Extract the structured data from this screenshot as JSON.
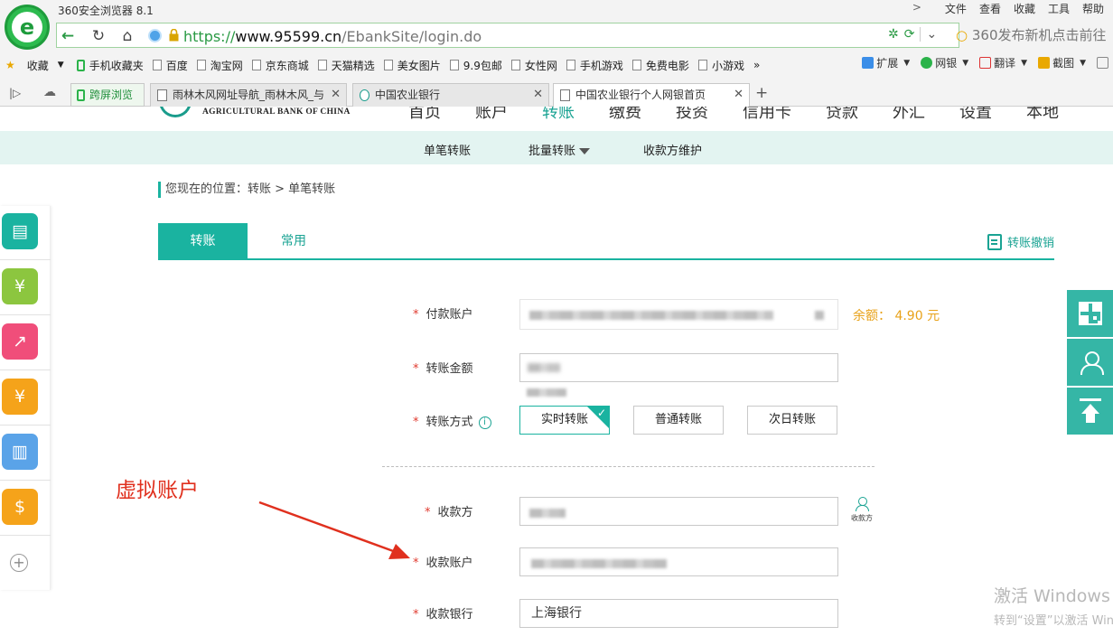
{
  "browser": {
    "app_title": "360安全浏览器 8.1",
    "menu": [
      "文件",
      "查看",
      "收藏",
      "工具",
      "帮助"
    ],
    "url": {
      "scheme": "https://",
      "domain": "www.95599.cn",
      "path": "/EbankSite/login.do"
    },
    "search_hint": "360发布新机点击前往",
    "bookmarks": [
      "收藏",
      "手机收藏夹",
      "百度",
      "淘宝网",
      "京东商城",
      "天猫精选",
      "美女图片",
      "9.9包邮",
      "女性网",
      "手机游戏",
      "免费电影",
      "小游戏"
    ],
    "bookmark_more": "»",
    "toolbar_right": [
      "扩展",
      "网银",
      "翻译",
      "截图"
    ],
    "tabs": [
      {
        "label": "跨屏浏览"
      },
      {
        "label": "雨林木风网址导航_雨林木风_与"
      },
      {
        "label": "中国农业银行"
      },
      {
        "label": "中国农业银行个人网银首页"
      }
    ],
    "new_tab": "+"
  },
  "bank": {
    "logo_text_en": "AGRICULTURAL BANK OF CHINA",
    "main_nav": [
      "首页",
      "账户",
      "转账",
      "缴费",
      "投资",
      "信用卡",
      "贷款",
      "外汇",
      "设置",
      "本地"
    ],
    "sub_nav": [
      "单笔转账",
      "批量转账",
      "收款方维护"
    ],
    "breadcrumb": "您现在的位置：转账 > 单笔转账",
    "tabs": {
      "transfer": "转账",
      "common": "常用",
      "revoke": "转账撤销"
    },
    "form": {
      "payer_label": "付款账户",
      "balance": "余额：  4.90 元",
      "amount_label": "转账金额",
      "method_label": "转账方式",
      "methods": [
        "实时转账",
        "普通转账",
        "次日转账"
      ],
      "selected_method": "实时转账",
      "payee_label": "收款方",
      "payee_icon_label": "收款方",
      "payee_account_label": "收款账户",
      "payee_bank_label": "收款银行",
      "payee_bank_value": "上海银行"
    }
  },
  "annotation": {
    "text": "虚拟账户",
    "color": "#e0301e"
  },
  "watermark": {
    "line1": "激活 Windows",
    "line2": "转到“设置”以激活 Windows。"
  },
  "colors": {
    "accent": "#1ab3a0",
    "balance": "#e8a21a",
    "required": "#e03a2f"
  }
}
